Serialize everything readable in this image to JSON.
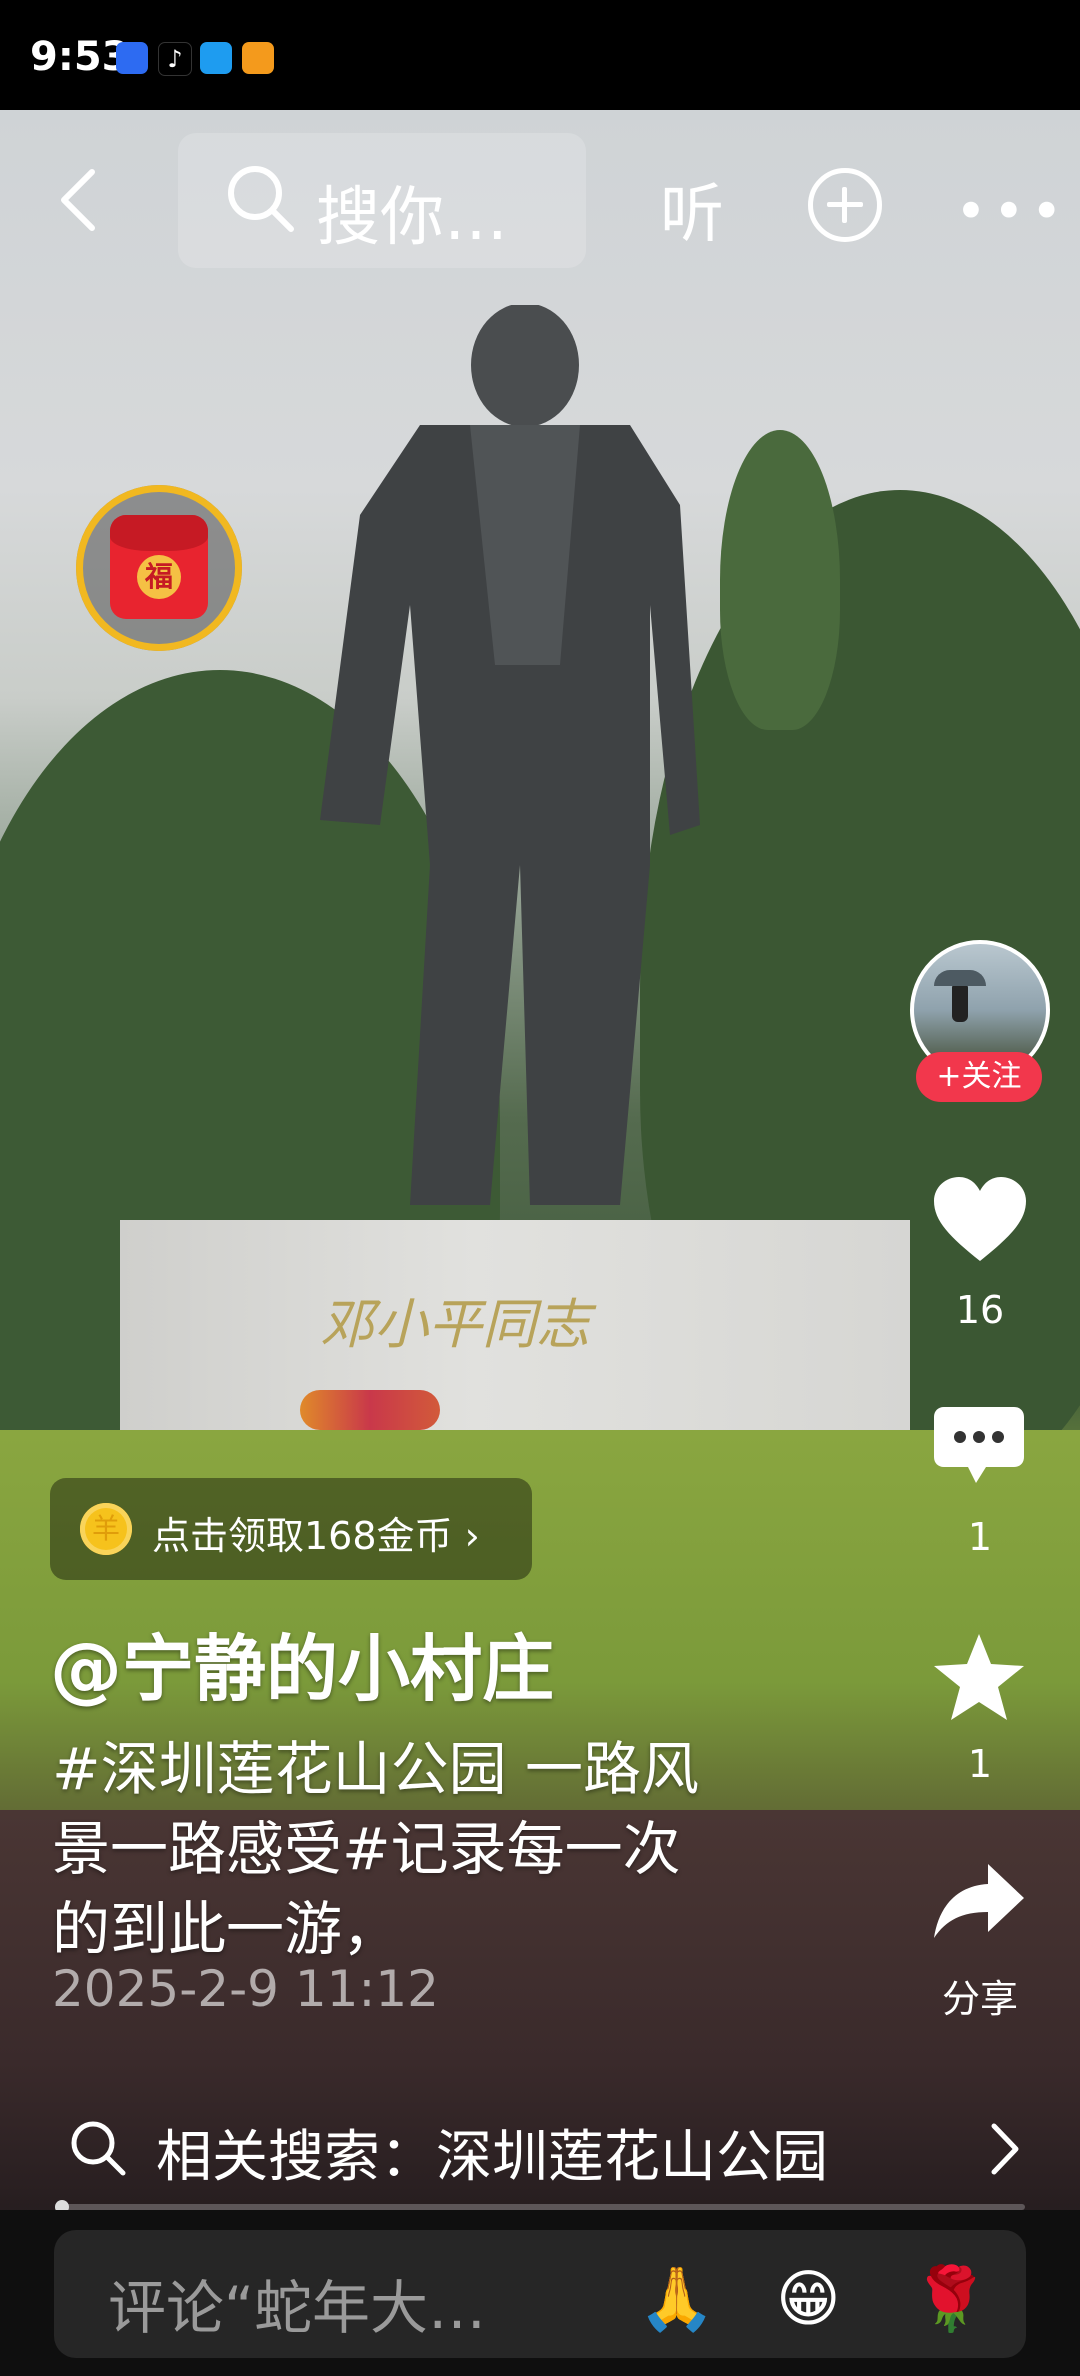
{
  "status_bar": {
    "time": "9:53",
    "app_icons": [
      "baidu-app-icon",
      "tiktok-app-icon",
      "message-app-icon",
      "orange-app-icon"
    ]
  },
  "top_bar": {
    "search_placeholder": "搜你…",
    "listen_label": "听"
  },
  "rail": {
    "follow_label": "+关注",
    "like_count": "16",
    "comment_count": "1",
    "favorite_count": "1",
    "share_label": "分享"
  },
  "red_envelope": {
    "label": "福",
    "accent": "#f1b820"
  },
  "statue": {
    "inscription": "邓小平同志"
  },
  "coin_pill": {
    "coin_symbol": "羊",
    "label": "点击领取168金币 ›"
  },
  "caption": {
    "author": "@宁静的小村庄",
    "lines": [
      "#深圳莲花山公园 一路风",
      "景一路感受#记录每一次",
      "的到此一游，"
    ],
    "date": "2025-2-9 11:12"
  },
  "related_search": {
    "label": "相关搜索：深圳莲花山公园"
  },
  "comment_bar": {
    "placeholder": "评论“蛇年大…",
    "emojis": [
      "🙏",
      "😁",
      "🌹"
    ]
  },
  "colors": {
    "follow_red": "#f2374c",
    "coin_gold": "#f6c21c"
  }
}
